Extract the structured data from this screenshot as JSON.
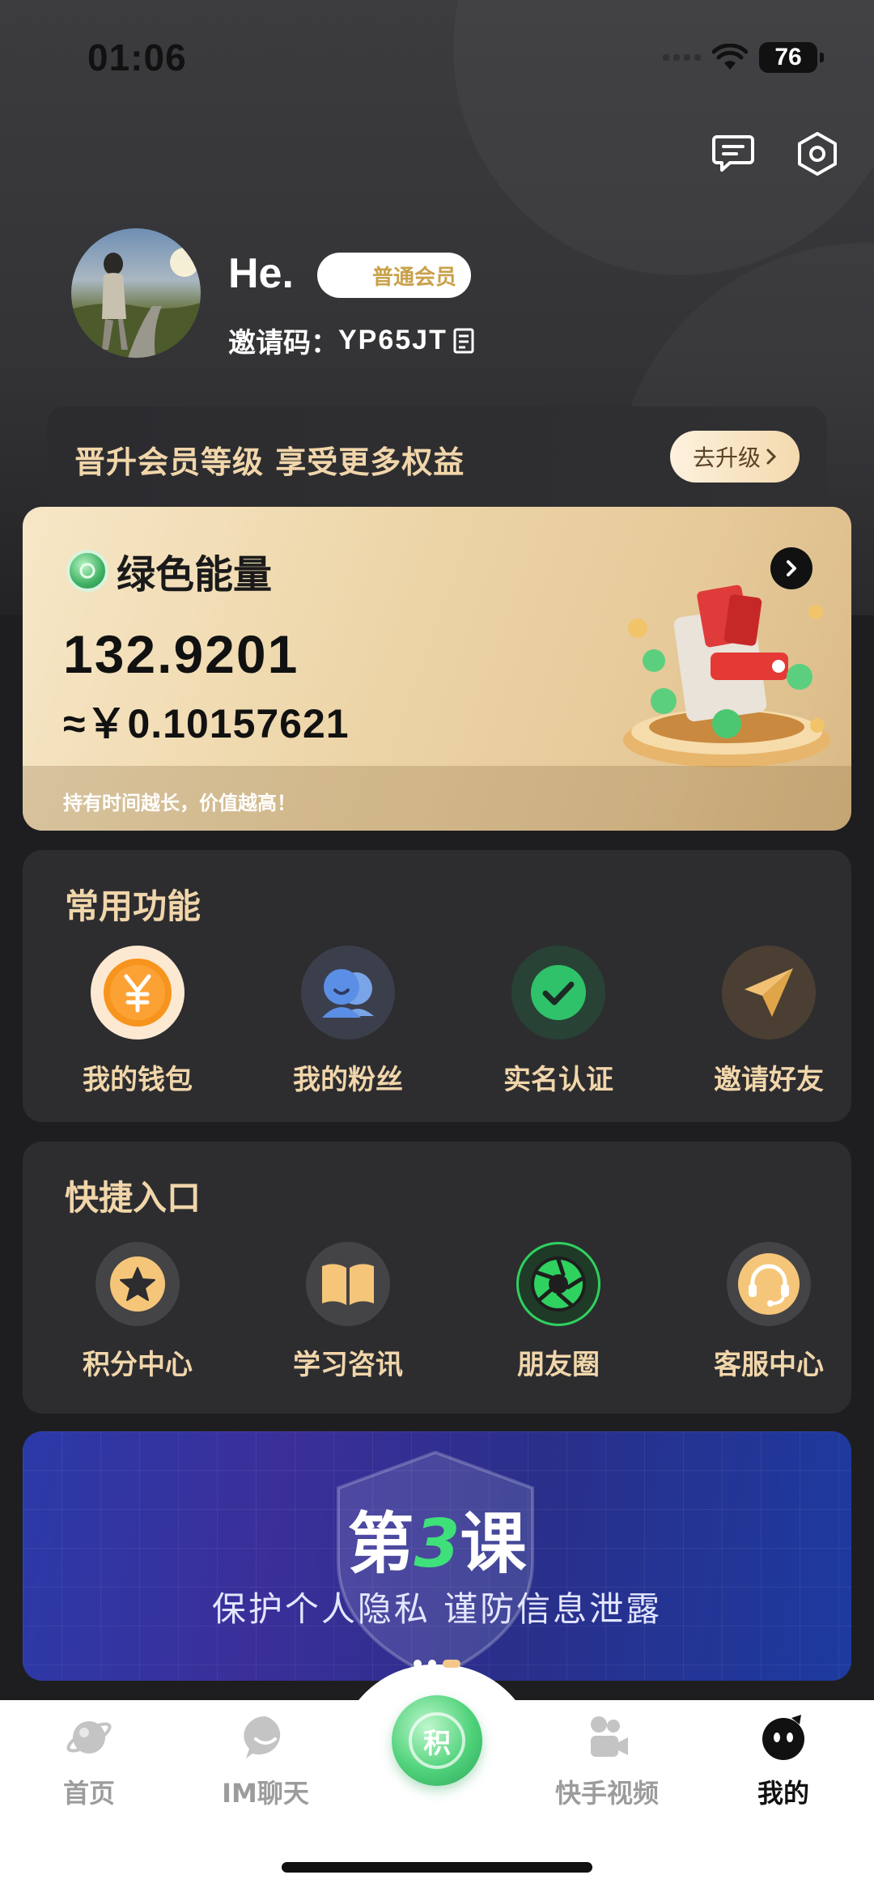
{
  "status_bar": {
    "time": "01:06",
    "battery": "76"
  },
  "profile": {
    "name": "He.",
    "member_level": "普通会员",
    "invite_label": "邀请码：",
    "invite_code": "YP65JT"
  },
  "upgrade": {
    "text": "晋升会员等级   享受更多权益",
    "button_label": "去升级"
  },
  "energy": {
    "title": "绿色能量",
    "value": "132.9201",
    "cny_value": "≈￥0.10157621",
    "tip": "持有时间越长，价值越高！"
  },
  "common_functions": {
    "title": "常用功能",
    "items": [
      {
        "label": "我的钱包",
        "icon": "wallet-yuan-icon"
      },
      {
        "label": "我的粉丝",
        "icon": "fans-icon"
      },
      {
        "label": "实名认证",
        "icon": "verified-check-icon"
      },
      {
        "label": "邀请好友",
        "icon": "paper-plane-icon"
      }
    ]
  },
  "quick_entries": {
    "title": "快捷入口",
    "items": [
      {
        "label": "积分中心",
        "icon": "star-icon"
      },
      {
        "label": "学习咨讯",
        "icon": "book-icon"
      },
      {
        "label": "朋友圈",
        "icon": "camera-aperture-icon"
      },
      {
        "label": "客服中心",
        "icon": "headset-icon"
      }
    ]
  },
  "banner": {
    "title_prefix": "第",
    "title_number": "3",
    "title_suffix": "课",
    "subtitle": "保护个人隐私   谨防信息泄露",
    "active_dot": 2
  },
  "bottom_nav": {
    "items": [
      {
        "label": "首页",
        "icon": "planet-icon"
      },
      {
        "label": "IM聊天",
        "icon": "chat-icon"
      },
      {
        "label": "快手视频",
        "icon": "video-camera-icon"
      },
      {
        "label": "我的",
        "icon": "profile-face-icon",
        "active": true
      }
    ],
    "center_label": "积"
  },
  "colors": {
    "accent_gold": "#f1d6aa",
    "panel_bg": "#2d2d30",
    "page_bg": "#1e1e21",
    "energy_green": "#3fb062"
  }
}
